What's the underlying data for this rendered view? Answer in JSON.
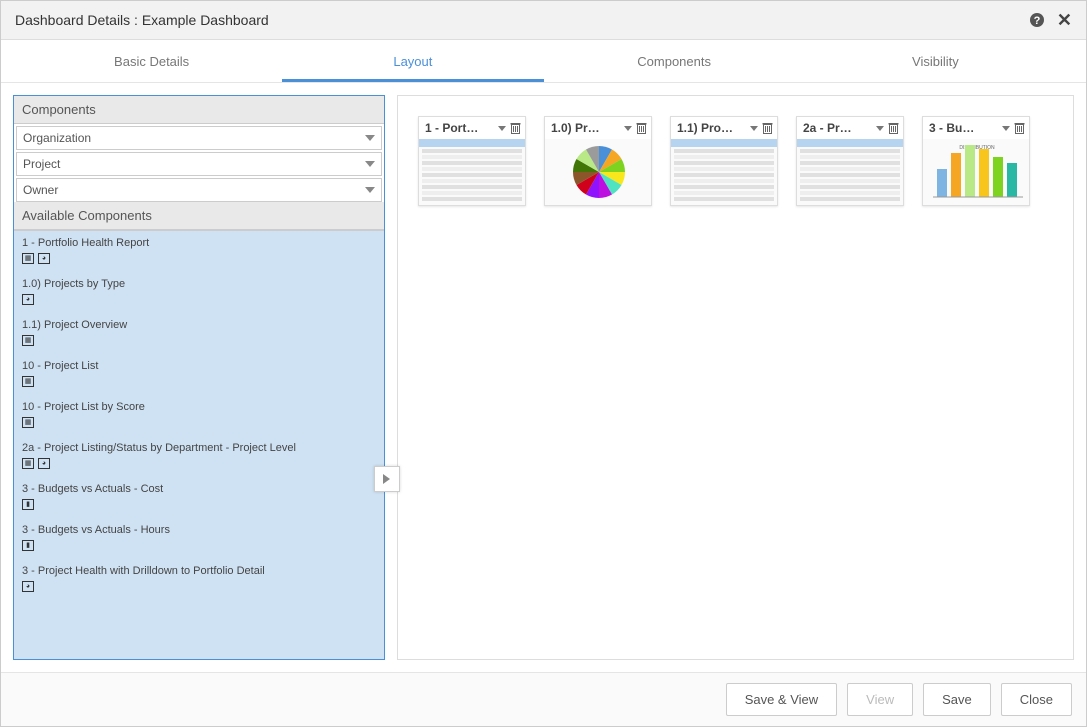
{
  "header": {
    "title": "Dashboard Details : Example Dashboard"
  },
  "tabs": [
    {
      "label": "Basic Details",
      "active": false
    },
    {
      "label": "Layout",
      "active": true
    },
    {
      "label": "Components",
      "active": false
    },
    {
      "label": "Visibility",
      "active": false
    }
  ],
  "left": {
    "components_header": "Components",
    "filters": [
      {
        "label": "Organization"
      },
      {
        "label": "Project"
      },
      {
        "label": "Owner"
      }
    ],
    "available_header": "Available Components",
    "available": [
      {
        "label": "1 - Portfolio Health Report",
        "icons": [
          "table",
          "chart"
        ]
      },
      {
        "label": "1.0) Projects by Type",
        "icons": [
          "chart"
        ]
      },
      {
        "label": "1.1) Project Overview",
        "icons": [
          "table"
        ]
      },
      {
        "label": "10 - Project List",
        "icons": [
          "table"
        ]
      },
      {
        "label": "10 - Project List by Score",
        "icons": [
          "table"
        ]
      },
      {
        "label": "2a - Project Listing/Status by Department - Project Level",
        "icons": [
          "table",
          "chart"
        ]
      },
      {
        "label": "3 - Budgets vs Actuals - Cost",
        "icons": [
          "bars"
        ]
      },
      {
        "label": "3 - Budgets vs Actuals - Hours",
        "icons": [
          "bars"
        ]
      },
      {
        "label": "3 - Project Health with Drilldown to Portfolio Detail",
        "icons": [
          "chart"
        ]
      }
    ]
  },
  "widgets": [
    {
      "title": "1 - Port…",
      "type": "table"
    },
    {
      "title": "1.0) Pr…",
      "type": "pie"
    },
    {
      "title": "1.1) Pro…",
      "type": "table"
    },
    {
      "title": "2a - Pr…",
      "type": "table"
    },
    {
      "title": "3 - Bu…",
      "type": "bar"
    }
  ],
  "footer": {
    "save_view": "Save & View",
    "view": "View",
    "save": "Save",
    "close": "Close"
  }
}
